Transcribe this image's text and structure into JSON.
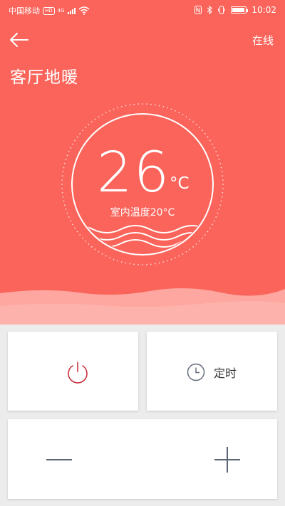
{
  "status_bar": {
    "carrier": "中国移动",
    "hd": "HD",
    "network": "4G",
    "time": "10:02",
    "battery_level": 0.95
  },
  "header": {
    "online_status": "在线",
    "title": "客厅地暖"
  },
  "thermostat": {
    "set_temperature": "26",
    "unit": "°C",
    "indoor_label": "室内温度20°C"
  },
  "controls": {
    "timer_label": "定时"
  },
  "colors": {
    "accent": "#fa645a",
    "power_icon": "#c8323c",
    "icon_gray": "#5e6675"
  }
}
